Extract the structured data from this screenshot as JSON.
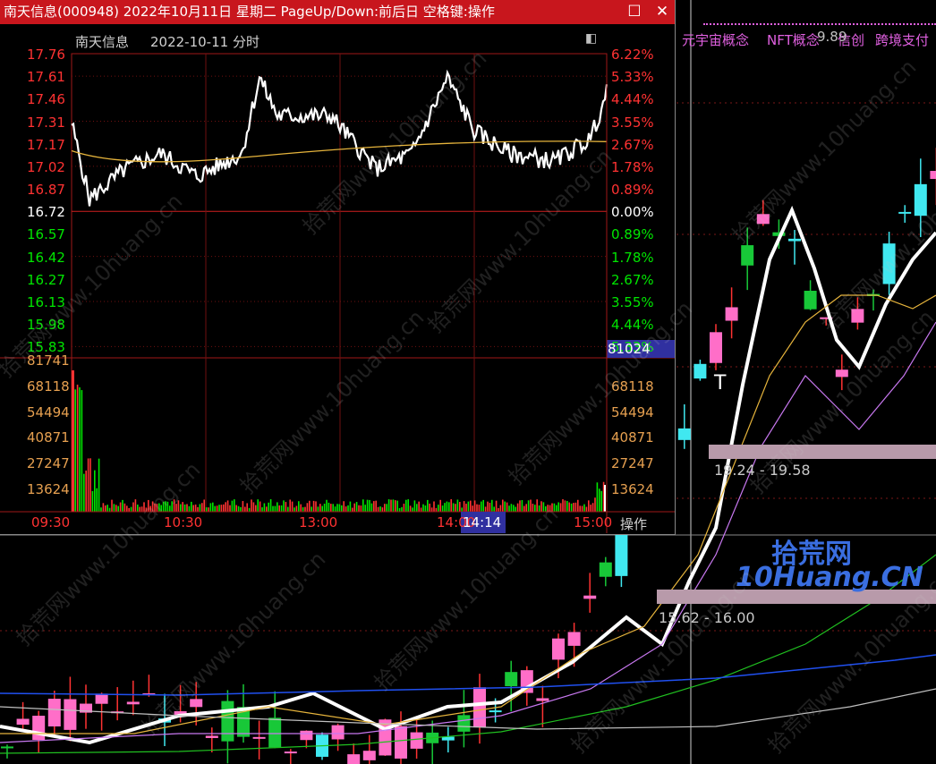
{
  "window": {
    "title": "南天信息(000948) 2022年10月11日 星期二 PageUp/Down:前后日 空格键:操作",
    "restore_icon": "restore-window-icon",
    "close_icon": "close-icon"
  },
  "intraday": {
    "header_name": "南天信息",
    "header_date": "2022-10-11 分时",
    "price_ticks": [
      "17.76",
      "17.61",
      "17.46",
      "17.31",
      "17.17",
      "17.02",
      "16.87",
      "16.72",
      "16.57",
      "16.42",
      "16.27",
      "16.13",
      "15.98",
      "15.83"
    ],
    "pct_ticks": [
      "6.22%",
      "5.33%",
      "4.44%",
      "3.55%",
      "2.67%",
      "1.78%",
      "0.89%",
      "0.00%",
      "0.89%",
      "1.78%",
      "2.67%",
      "3.55%",
      "4.44%",
      "5.33%"
    ],
    "volume_ticks_left": [
      "81741",
      "68118",
      "54494",
      "40871",
      "27247",
      "13624"
    ],
    "volume_ticks_right": [
      "81741",
      "68118",
      "54494",
      "40871",
      "27247",
      "13624"
    ],
    "volume_highlight": "81024",
    "time_labels": [
      "09:30",
      "10:30",
      "13:00",
      "14:00",
      "15:00"
    ],
    "cursor_time": "14:14",
    "operate_label": "操作",
    "colors": {
      "up": "#ff3232",
      "down": "#00e600",
      "neutral": "#ffffff",
      "avg": "#e6b43c",
      "volume_label": "#e6a050"
    }
  },
  "kline": {
    "concept_tags": [
      "元宇宙概念",
      "NFT概念",
      "信创",
      "跨境支付"
    ],
    "current_price_partial": "9.89",
    "zone_upper": "19.24 - 19.58",
    "zone_lower": "15.62 - 16.00",
    "cursor_mark": "T",
    "colors": {
      "up": "#ff6ec8",
      "down_solid": "#18c838",
      "hollow_down": "#40e8f0",
      "ma5": "#ffffff",
      "ma10": "#e6b43c",
      "ma20": "#c878f0",
      "ma60": "#20c020",
      "ma120": "#2050f0",
      "ma250": "#c0c0c0"
    }
  },
  "watermark": {
    "text": "拾荒网www.10huang.cn",
    "logo_cn": "拾荒网",
    "logo_en": "10Huang.CN"
  }
}
